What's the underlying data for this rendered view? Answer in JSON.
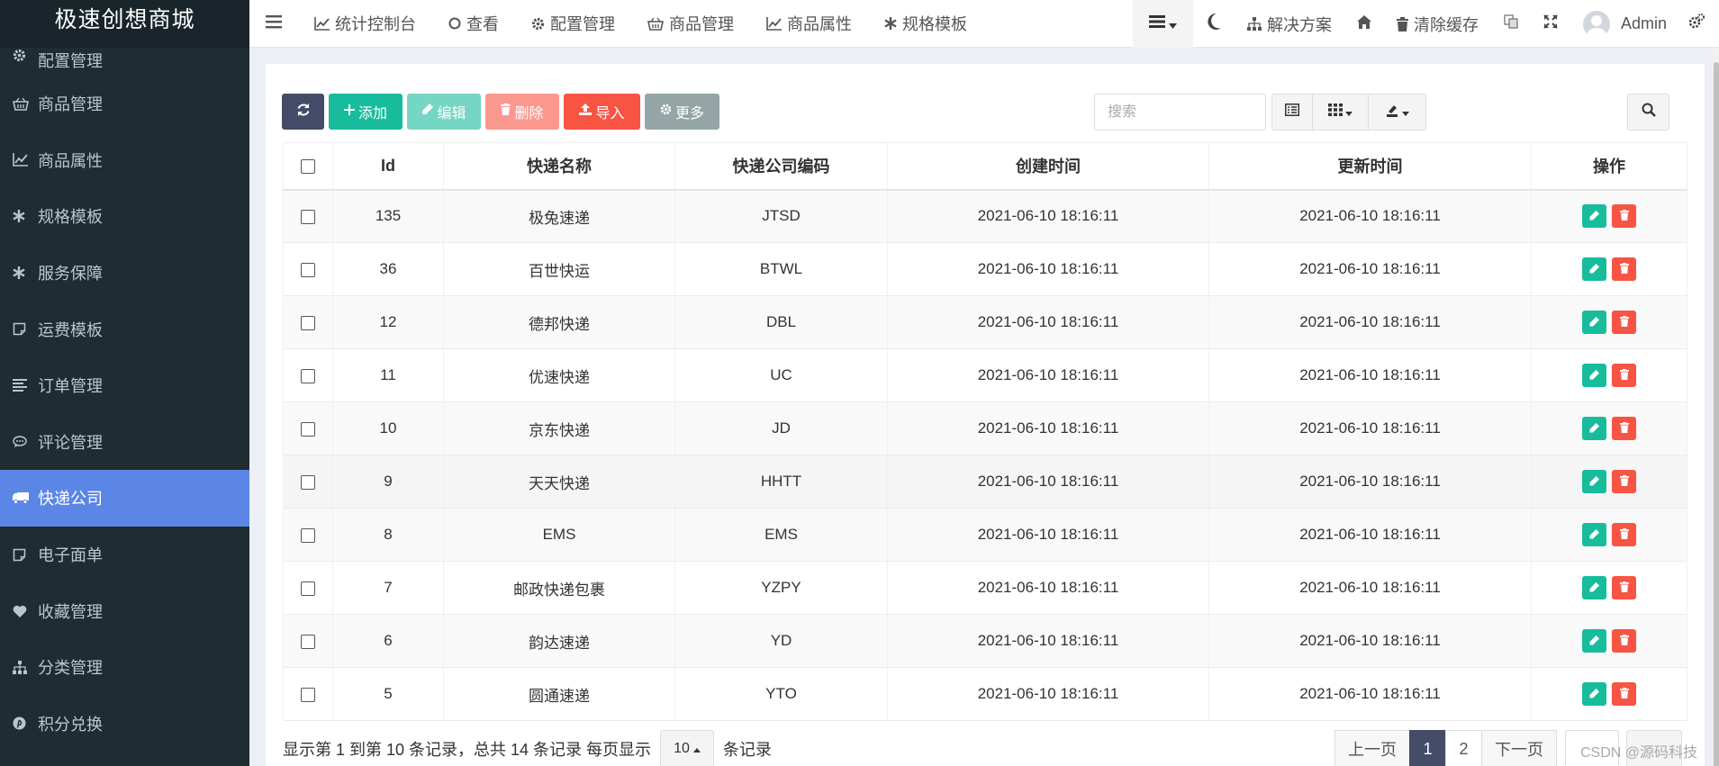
{
  "brand": "极速创想商城",
  "sidebar": {
    "items": [
      {
        "label": "配置管理",
        "icon": "gear-icon"
      },
      {
        "label": "商品管理",
        "icon": "basket-icon"
      },
      {
        "label": "商品属性",
        "icon": "line-chart-icon"
      },
      {
        "label": "规格模板",
        "icon": "asterisk-icon"
      },
      {
        "label": "服务保障",
        "icon": "asterisk-icon"
      },
      {
        "label": "运费模板",
        "icon": "note-icon"
      },
      {
        "label": "订单管理",
        "icon": "list-icon"
      },
      {
        "label": "评论管理",
        "icon": "comment-icon"
      },
      {
        "label": "快递公司",
        "icon": "truck-icon"
      },
      {
        "label": "电子面单",
        "icon": "note-icon"
      },
      {
        "label": "收藏管理",
        "icon": "heart-icon"
      },
      {
        "label": "分类管理",
        "icon": "sitemap-icon"
      },
      {
        "label": "积分兑换",
        "icon": "pinterest-icon"
      }
    ],
    "active": "快递公司"
  },
  "topbar": {
    "nav": [
      {
        "label": "统计控制台",
        "icon": "line-chart-icon"
      },
      {
        "label": "查看",
        "icon": "circle-icon"
      },
      {
        "label": "配置管理",
        "icon": "gear-icon"
      },
      {
        "label": "商品管理",
        "icon": "basket-icon"
      },
      {
        "label": "商品属性",
        "icon": "line-chart-icon"
      },
      {
        "label": "规格模板",
        "icon": "asterisk-icon"
      }
    ],
    "solutions": "解决方案",
    "clear_cache": "清除缓存",
    "user": "Admin"
  },
  "toolbar": {
    "add": "添加",
    "edit": "编辑",
    "delete": "删除",
    "import": "导入",
    "more": "更多",
    "search_placeholder": "搜索"
  },
  "table": {
    "headers": [
      "Id",
      "快递名称",
      "快递公司编码",
      "创建时间",
      "更新时间",
      "操作"
    ],
    "rows": [
      {
        "id": "135",
        "name": "极兔速递",
        "code": "JTSD",
        "created": "2021-06-10 18:16:11",
        "updated": "2021-06-10 18:16:11"
      },
      {
        "id": "36",
        "name": "百世快运",
        "code": "BTWL",
        "created": "2021-06-10 18:16:11",
        "updated": "2021-06-10 18:16:11"
      },
      {
        "id": "12",
        "name": "德邦快递",
        "code": "DBL",
        "created": "2021-06-10 18:16:11",
        "updated": "2021-06-10 18:16:11"
      },
      {
        "id": "11",
        "name": "优速快递",
        "code": "UC",
        "created": "2021-06-10 18:16:11",
        "updated": "2021-06-10 18:16:11"
      },
      {
        "id": "10",
        "name": "京东快递",
        "code": "JD",
        "created": "2021-06-10 18:16:11",
        "updated": "2021-06-10 18:16:11"
      },
      {
        "id": "9",
        "name": "天天快递",
        "code": "HHTT",
        "created": "2021-06-10 18:16:11",
        "updated": "2021-06-10 18:16:11"
      },
      {
        "id": "8",
        "name": "EMS",
        "code": "EMS",
        "created": "2021-06-10 18:16:11",
        "updated": "2021-06-10 18:16:11"
      },
      {
        "id": "7",
        "name": "邮政快递包裹",
        "code": "YZPY",
        "created": "2021-06-10 18:16:11",
        "updated": "2021-06-10 18:16:11"
      },
      {
        "id": "6",
        "name": "韵达速递",
        "code": "YD",
        "created": "2021-06-10 18:16:11",
        "updated": "2021-06-10 18:16:11"
      },
      {
        "id": "5",
        "name": "圆通速递",
        "code": "YTO",
        "created": "2021-06-10 18:16:11",
        "updated": "2021-06-10 18:16:11"
      }
    ]
  },
  "footer": {
    "info_prefix": "显示第 1 到第 10 条记录，总共 14 条记录 每页显示",
    "page_size": "10",
    "info_suffix": "条记录"
  },
  "pagination": {
    "prev": "上一页",
    "pages": [
      "1",
      "2"
    ],
    "current": "1",
    "next": "下一页"
  },
  "watermark": "CSDN @源码科技",
  "colors": {
    "sidebar_bg": "#1f2d32",
    "sidebar_active": "#5b86e5",
    "success": "#18bc9c",
    "danger": "#f75444",
    "primary_dark": "#444c69"
  }
}
